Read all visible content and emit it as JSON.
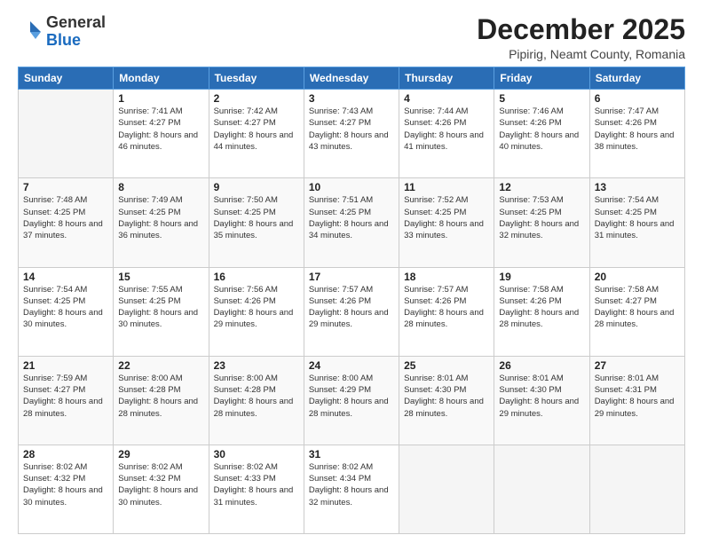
{
  "header": {
    "logo_general": "General",
    "logo_blue": "Blue",
    "month_title": "December 2025",
    "location": "Pipirig, Neamt County, Romania"
  },
  "days_of_week": [
    "Sunday",
    "Monday",
    "Tuesday",
    "Wednesday",
    "Thursday",
    "Friday",
    "Saturday"
  ],
  "weeks": [
    [
      {
        "day": "",
        "empty": true
      },
      {
        "day": "1",
        "sunrise": "Sunrise: 7:41 AM",
        "sunset": "Sunset: 4:27 PM",
        "daylight": "Daylight: 8 hours and 46 minutes."
      },
      {
        "day": "2",
        "sunrise": "Sunrise: 7:42 AM",
        "sunset": "Sunset: 4:27 PM",
        "daylight": "Daylight: 8 hours and 44 minutes."
      },
      {
        "day": "3",
        "sunrise": "Sunrise: 7:43 AM",
        "sunset": "Sunset: 4:27 PM",
        "daylight": "Daylight: 8 hours and 43 minutes."
      },
      {
        "day": "4",
        "sunrise": "Sunrise: 7:44 AM",
        "sunset": "Sunset: 4:26 PM",
        "daylight": "Daylight: 8 hours and 41 minutes."
      },
      {
        "day": "5",
        "sunrise": "Sunrise: 7:46 AM",
        "sunset": "Sunset: 4:26 PM",
        "daylight": "Daylight: 8 hours and 40 minutes."
      },
      {
        "day": "6",
        "sunrise": "Sunrise: 7:47 AM",
        "sunset": "Sunset: 4:26 PM",
        "daylight": "Daylight: 8 hours and 38 minutes."
      }
    ],
    [
      {
        "day": "7",
        "sunrise": "Sunrise: 7:48 AM",
        "sunset": "Sunset: 4:25 PM",
        "daylight": "Daylight: 8 hours and 37 minutes."
      },
      {
        "day": "8",
        "sunrise": "Sunrise: 7:49 AM",
        "sunset": "Sunset: 4:25 PM",
        "daylight": "Daylight: 8 hours and 36 minutes."
      },
      {
        "day": "9",
        "sunrise": "Sunrise: 7:50 AM",
        "sunset": "Sunset: 4:25 PM",
        "daylight": "Daylight: 8 hours and 35 minutes."
      },
      {
        "day": "10",
        "sunrise": "Sunrise: 7:51 AM",
        "sunset": "Sunset: 4:25 PM",
        "daylight": "Daylight: 8 hours and 34 minutes."
      },
      {
        "day": "11",
        "sunrise": "Sunrise: 7:52 AM",
        "sunset": "Sunset: 4:25 PM",
        "daylight": "Daylight: 8 hours and 33 minutes."
      },
      {
        "day": "12",
        "sunrise": "Sunrise: 7:53 AM",
        "sunset": "Sunset: 4:25 PM",
        "daylight": "Daylight: 8 hours and 32 minutes."
      },
      {
        "day": "13",
        "sunrise": "Sunrise: 7:54 AM",
        "sunset": "Sunset: 4:25 PM",
        "daylight": "Daylight: 8 hours and 31 minutes."
      }
    ],
    [
      {
        "day": "14",
        "sunrise": "Sunrise: 7:54 AM",
        "sunset": "Sunset: 4:25 PM",
        "daylight": "Daylight: 8 hours and 30 minutes."
      },
      {
        "day": "15",
        "sunrise": "Sunrise: 7:55 AM",
        "sunset": "Sunset: 4:25 PM",
        "daylight": "Daylight: 8 hours and 30 minutes."
      },
      {
        "day": "16",
        "sunrise": "Sunrise: 7:56 AM",
        "sunset": "Sunset: 4:26 PM",
        "daylight": "Daylight: 8 hours and 29 minutes."
      },
      {
        "day": "17",
        "sunrise": "Sunrise: 7:57 AM",
        "sunset": "Sunset: 4:26 PM",
        "daylight": "Daylight: 8 hours and 29 minutes."
      },
      {
        "day": "18",
        "sunrise": "Sunrise: 7:57 AM",
        "sunset": "Sunset: 4:26 PM",
        "daylight": "Daylight: 8 hours and 28 minutes."
      },
      {
        "day": "19",
        "sunrise": "Sunrise: 7:58 AM",
        "sunset": "Sunset: 4:26 PM",
        "daylight": "Daylight: 8 hours and 28 minutes."
      },
      {
        "day": "20",
        "sunrise": "Sunrise: 7:58 AM",
        "sunset": "Sunset: 4:27 PM",
        "daylight": "Daylight: 8 hours and 28 minutes."
      }
    ],
    [
      {
        "day": "21",
        "sunrise": "Sunrise: 7:59 AM",
        "sunset": "Sunset: 4:27 PM",
        "daylight": "Daylight: 8 hours and 28 minutes."
      },
      {
        "day": "22",
        "sunrise": "Sunrise: 8:00 AM",
        "sunset": "Sunset: 4:28 PM",
        "daylight": "Daylight: 8 hours and 28 minutes."
      },
      {
        "day": "23",
        "sunrise": "Sunrise: 8:00 AM",
        "sunset": "Sunset: 4:28 PM",
        "daylight": "Daylight: 8 hours and 28 minutes."
      },
      {
        "day": "24",
        "sunrise": "Sunrise: 8:00 AM",
        "sunset": "Sunset: 4:29 PM",
        "daylight": "Daylight: 8 hours and 28 minutes."
      },
      {
        "day": "25",
        "sunrise": "Sunrise: 8:01 AM",
        "sunset": "Sunset: 4:30 PM",
        "daylight": "Daylight: 8 hours and 28 minutes."
      },
      {
        "day": "26",
        "sunrise": "Sunrise: 8:01 AM",
        "sunset": "Sunset: 4:30 PM",
        "daylight": "Daylight: 8 hours and 29 minutes."
      },
      {
        "day": "27",
        "sunrise": "Sunrise: 8:01 AM",
        "sunset": "Sunset: 4:31 PM",
        "daylight": "Daylight: 8 hours and 29 minutes."
      }
    ],
    [
      {
        "day": "28",
        "sunrise": "Sunrise: 8:02 AM",
        "sunset": "Sunset: 4:32 PM",
        "daylight": "Daylight: 8 hours and 30 minutes."
      },
      {
        "day": "29",
        "sunrise": "Sunrise: 8:02 AM",
        "sunset": "Sunset: 4:32 PM",
        "daylight": "Daylight: 8 hours and 30 minutes."
      },
      {
        "day": "30",
        "sunrise": "Sunrise: 8:02 AM",
        "sunset": "Sunset: 4:33 PM",
        "daylight": "Daylight: 8 hours and 31 minutes."
      },
      {
        "day": "31",
        "sunrise": "Sunrise: 8:02 AM",
        "sunset": "Sunset: 4:34 PM",
        "daylight": "Daylight: 8 hours and 32 minutes."
      },
      {
        "day": "",
        "empty": true
      },
      {
        "day": "",
        "empty": true
      },
      {
        "day": "",
        "empty": true
      }
    ]
  ]
}
